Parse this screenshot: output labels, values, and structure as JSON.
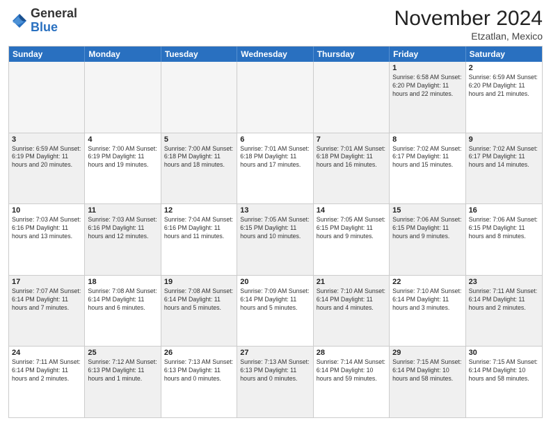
{
  "logo": {
    "general": "General",
    "blue": "Blue"
  },
  "header": {
    "month": "November 2024",
    "location": "Etzatlan, Mexico"
  },
  "weekdays": [
    "Sunday",
    "Monday",
    "Tuesday",
    "Wednesday",
    "Thursday",
    "Friday",
    "Saturday"
  ],
  "rows": [
    [
      {
        "day": "",
        "text": "",
        "empty": true
      },
      {
        "day": "",
        "text": "",
        "empty": true
      },
      {
        "day": "",
        "text": "",
        "empty": true
      },
      {
        "day": "",
        "text": "",
        "empty": true
      },
      {
        "day": "",
        "text": "",
        "empty": true
      },
      {
        "day": "1",
        "text": "Sunrise: 6:58 AM\nSunset: 6:20 PM\nDaylight: 11 hours and 22 minutes.",
        "shaded": true
      },
      {
        "day": "2",
        "text": "Sunrise: 6:59 AM\nSunset: 6:20 PM\nDaylight: 11 hours and 21 minutes.",
        "shaded": false
      }
    ],
    [
      {
        "day": "3",
        "text": "Sunrise: 6:59 AM\nSunset: 6:19 PM\nDaylight: 11 hours and 20 minutes.",
        "shaded": true
      },
      {
        "day": "4",
        "text": "Sunrise: 7:00 AM\nSunset: 6:19 PM\nDaylight: 11 hours and 19 minutes.",
        "shaded": false
      },
      {
        "day": "5",
        "text": "Sunrise: 7:00 AM\nSunset: 6:18 PM\nDaylight: 11 hours and 18 minutes.",
        "shaded": true
      },
      {
        "day": "6",
        "text": "Sunrise: 7:01 AM\nSunset: 6:18 PM\nDaylight: 11 hours and 17 minutes.",
        "shaded": false
      },
      {
        "day": "7",
        "text": "Sunrise: 7:01 AM\nSunset: 6:18 PM\nDaylight: 11 hours and 16 minutes.",
        "shaded": true
      },
      {
        "day": "8",
        "text": "Sunrise: 7:02 AM\nSunset: 6:17 PM\nDaylight: 11 hours and 15 minutes.",
        "shaded": false
      },
      {
        "day": "9",
        "text": "Sunrise: 7:02 AM\nSunset: 6:17 PM\nDaylight: 11 hours and 14 minutes.",
        "shaded": true
      }
    ],
    [
      {
        "day": "10",
        "text": "Sunrise: 7:03 AM\nSunset: 6:16 PM\nDaylight: 11 hours and 13 minutes.",
        "shaded": false
      },
      {
        "day": "11",
        "text": "Sunrise: 7:03 AM\nSunset: 6:16 PM\nDaylight: 11 hours and 12 minutes.",
        "shaded": true
      },
      {
        "day": "12",
        "text": "Sunrise: 7:04 AM\nSunset: 6:16 PM\nDaylight: 11 hours and 11 minutes.",
        "shaded": false
      },
      {
        "day": "13",
        "text": "Sunrise: 7:05 AM\nSunset: 6:15 PM\nDaylight: 11 hours and 10 minutes.",
        "shaded": true
      },
      {
        "day": "14",
        "text": "Sunrise: 7:05 AM\nSunset: 6:15 PM\nDaylight: 11 hours and 9 minutes.",
        "shaded": false
      },
      {
        "day": "15",
        "text": "Sunrise: 7:06 AM\nSunset: 6:15 PM\nDaylight: 11 hours and 9 minutes.",
        "shaded": true
      },
      {
        "day": "16",
        "text": "Sunrise: 7:06 AM\nSunset: 6:15 PM\nDaylight: 11 hours and 8 minutes.",
        "shaded": false
      }
    ],
    [
      {
        "day": "17",
        "text": "Sunrise: 7:07 AM\nSunset: 6:14 PM\nDaylight: 11 hours and 7 minutes.",
        "shaded": true
      },
      {
        "day": "18",
        "text": "Sunrise: 7:08 AM\nSunset: 6:14 PM\nDaylight: 11 hours and 6 minutes.",
        "shaded": false
      },
      {
        "day": "19",
        "text": "Sunrise: 7:08 AM\nSunset: 6:14 PM\nDaylight: 11 hours and 5 minutes.",
        "shaded": true
      },
      {
        "day": "20",
        "text": "Sunrise: 7:09 AM\nSunset: 6:14 PM\nDaylight: 11 hours and 5 minutes.",
        "shaded": false
      },
      {
        "day": "21",
        "text": "Sunrise: 7:10 AM\nSunset: 6:14 PM\nDaylight: 11 hours and 4 minutes.",
        "shaded": true
      },
      {
        "day": "22",
        "text": "Sunrise: 7:10 AM\nSunset: 6:14 PM\nDaylight: 11 hours and 3 minutes.",
        "shaded": false
      },
      {
        "day": "23",
        "text": "Sunrise: 7:11 AM\nSunset: 6:14 PM\nDaylight: 11 hours and 2 minutes.",
        "shaded": true
      }
    ],
    [
      {
        "day": "24",
        "text": "Sunrise: 7:11 AM\nSunset: 6:14 PM\nDaylight: 11 hours and 2 minutes.",
        "shaded": false
      },
      {
        "day": "25",
        "text": "Sunrise: 7:12 AM\nSunset: 6:13 PM\nDaylight: 11 hours and 1 minute.",
        "shaded": true
      },
      {
        "day": "26",
        "text": "Sunrise: 7:13 AM\nSunset: 6:13 PM\nDaylight: 11 hours and 0 minutes.",
        "shaded": false
      },
      {
        "day": "27",
        "text": "Sunrise: 7:13 AM\nSunset: 6:13 PM\nDaylight: 11 hours and 0 minutes.",
        "shaded": true
      },
      {
        "day": "28",
        "text": "Sunrise: 7:14 AM\nSunset: 6:14 PM\nDaylight: 10 hours and 59 minutes.",
        "shaded": false
      },
      {
        "day": "29",
        "text": "Sunrise: 7:15 AM\nSunset: 6:14 PM\nDaylight: 10 hours and 58 minutes.",
        "shaded": true
      },
      {
        "day": "30",
        "text": "Sunrise: 7:15 AM\nSunset: 6:14 PM\nDaylight: 10 hours and 58 minutes.",
        "shaded": false
      }
    ]
  ]
}
